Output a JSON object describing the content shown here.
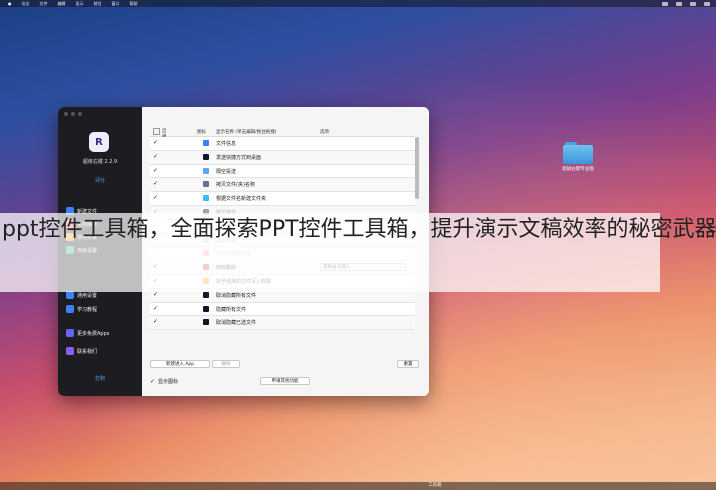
{
  "menubar": {
    "items": [
      "访达",
      "文件",
      "编辑",
      "显示",
      "前往",
      "窗口",
      "帮助"
    ]
  },
  "desktop": {
    "folder_label": "超级右键专业版"
  },
  "app": {
    "name": "超级右键 2.2.9",
    "rate": "评分",
    "sidebar": [
      {
        "label": "新建文件",
        "color": "#3b82f6"
      },
      {
        "label": "常用操作",
        "color": "#ef4444"
      },
      {
        "label": "常用目录",
        "color": "#f59e0b"
      },
      {
        "label": "高级设置",
        "color": "#10b981"
      },
      {
        "label": "通用设置",
        "color": "#3b82f6"
      },
      {
        "label": "学习教程",
        "color": "#3b82f6"
      },
      {
        "label": "更多免费Apps",
        "color": "#6366f1"
      },
      {
        "label": "联系我们",
        "color": "#8b5cf6"
      }
    ],
    "footer": "打购"
  },
  "table": {
    "headers": [
      "启用",
      "图标",
      "显示名称 (单击编辑/拖住拖拽)",
      "选项"
    ],
    "rows": [
      {
        "checked": "✓",
        "label": "文件信息",
        "icon_color": "#3b82f6",
        "faded": false
      },
      {
        "checked": "✓",
        "label": "发送快捷方式到桌面",
        "icon_color": "#111827",
        "faded": false
      },
      {
        "checked": "✓",
        "label": "隔空投送",
        "icon_color": "#60a5fa",
        "faded": false
      },
      {
        "checked": "✓",
        "label": "拷贝文件(夹)名称",
        "icon_color": "#64748b",
        "faded": false
      },
      {
        "checked": "✓",
        "label": "根据文件名新建文件夹",
        "icon_color": "#38bdf8",
        "faded": false
      },
      {
        "checked": "✓",
        "label": "拷贝路径",
        "icon_color": "#9ca3af",
        "faded": true
      },
      {
        "checked": "✓",
        "label": "iShot截图",
        "icon_color": "#93c5fd",
        "faded": true
      },
      {
        "checked": "✓",
        "label": "拷贝目录",
        "icon_color": "#d1d5db",
        "faded": true
      },
      {
        "checked": "✓",
        "label": "添加到常用目录",
        "icon_color": "#fca5a5",
        "faded": true
      },
      {
        "checked": "✓",
        "label": "彻底删除",
        "icon_color": "#ef4444",
        "faded": false,
        "option": "需要再次确认"
      },
      {
        "checked": "✓",
        "label": "授予选择的文件写入权限",
        "icon_color": "#f59e0b",
        "faded": false
      },
      {
        "checked": "✓",
        "label": "取消隐藏所有文件",
        "icon_color": "#111827",
        "faded": false
      },
      {
        "checked": "✓",
        "label": "隐藏所有文件",
        "icon_color": "#111827",
        "faded": false
      },
      {
        "checked": "✓",
        "label": "取消隐藏已选文件",
        "icon_color": "#111827",
        "faded": false
      }
    ]
  },
  "buttons": {
    "new_app": "新建进入 App",
    "delete": "删除",
    "reset": "重置",
    "request": "申请其他功能"
  },
  "show_icon": {
    "checked": "✓",
    "label": "显示图标"
  },
  "overlay": {
    "text": "ppt控件工具箱，全面探索PPT控件工具箱，提升演示文稿效率的秘密武器"
  },
  "dock": {
    "label": "工具箱"
  }
}
